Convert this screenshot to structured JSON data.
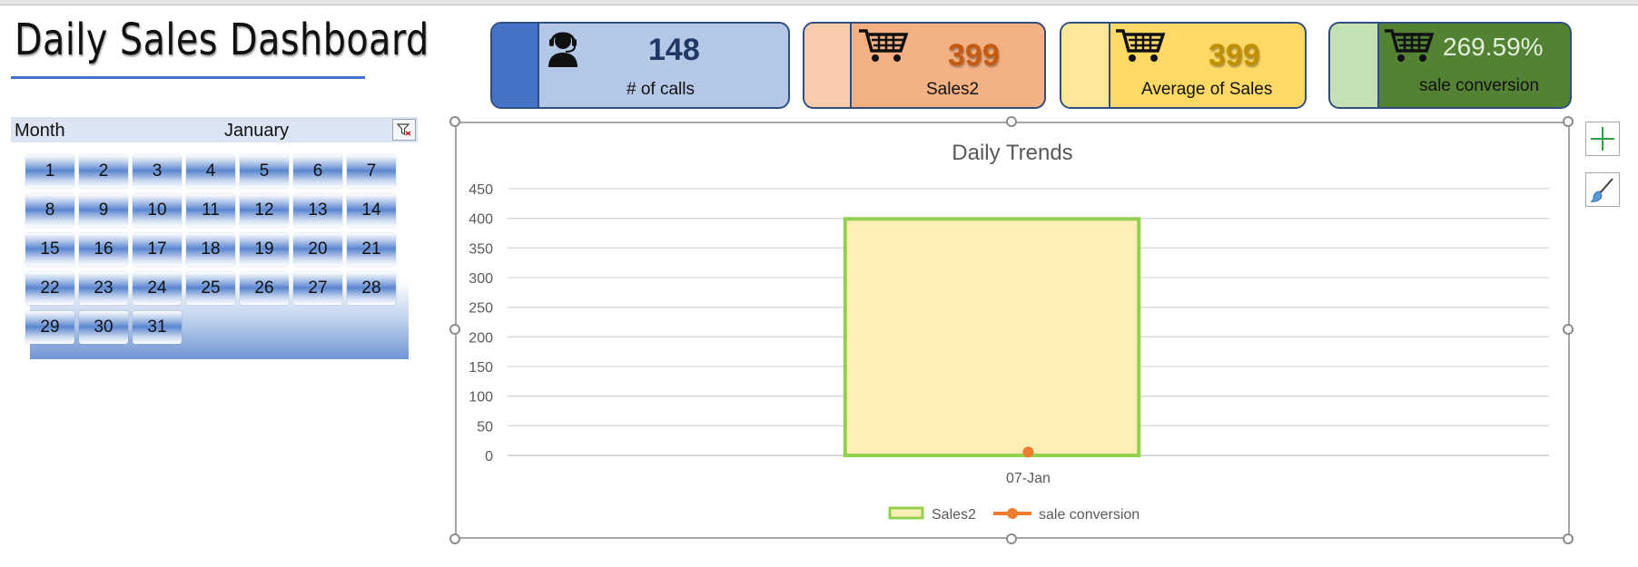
{
  "title": "Daily Sales Dashboard",
  "slicer": {
    "field": "Month",
    "selected": "January",
    "days": [
      "1",
      "2",
      "3",
      "4",
      "5",
      "6",
      "7",
      "8",
      "9",
      "10",
      "11",
      "12",
      "13",
      "14",
      "15",
      "16",
      "17",
      "18",
      "19",
      "20",
      "21",
      "22",
      "23",
      "24",
      "25",
      "26",
      "27",
      "28",
      "29",
      "30",
      "31"
    ]
  },
  "kpis": [
    {
      "icon": "headset-person-icon",
      "value": "148",
      "label": "# of calls",
      "bg": "#b4c7e7",
      "stripe": "#4472c4",
      "value_color": "#1f3864",
      "label_color": "#111111"
    },
    {
      "icon": "shopping-cart-icon",
      "value": "399",
      "label": "Sales2",
      "bg": "#f4b183",
      "stripe": "#f8cbad",
      "value_color": "#c55a11",
      "label_color": "#111111"
    },
    {
      "icon": "shopping-cart-icon",
      "value": "399",
      "label": "Average of Sales",
      "bg": "#ffd966",
      "stripe": "#ffe699",
      "value_color": "#bf9000",
      "label_color": "#111111"
    },
    {
      "icon": "shopping-cart-icon",
      "value": "269.59%",
      "label": "sale conversion",
      "bg": "#548235",
      "stripe": "#c5e0b4",
      "value_color": "#e2efda",
      "label_color": "#111111"
    }
  ],
  "chart_data": {
    "type": "bar",
    "title": "Daily Trends",
    "categories": [
      "07-Jan"
    ],
    "series": [
      {
        "name": "Sales2",
        "type": "bar",
        "values": [
          399
        ],
        "fill": "#ffeeb5",
        "stroke": "#92d050"
      },
      {
        "name": "sale conversion",
        "type": "line",
        "values": [
          2.6959
        ],
        "color": "#ed7d31"
      }
    ],
    "y_ticks": [
      "0",
      "50",
      "100",
      "150",
      "200",
      "250",
      "300",
      "350",
      "400",
      "450"
    ],
    "ylim": [
      0,
      450
    ],
    "grid": true,
    "legend": "bottom"
  }
}
